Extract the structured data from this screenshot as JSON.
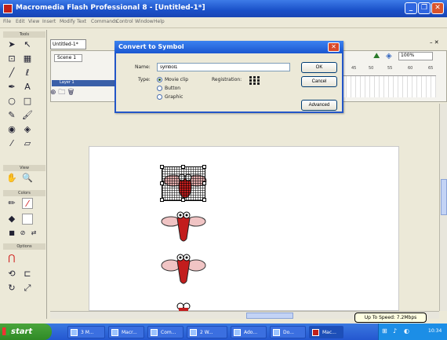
{
  "window": {
    "title": "Macromedia Flash Professional 8 - [Untitled-1*]",
    "min_label": "_",
    "max_label": "❐",
    "close_label": "✕"
  },
  "menu": [
    "File",
    "Edit",
    "View",
    "Insert",
    "Modify",
    "Text",
    "Commands",
    "Control",
    "Window",
    "Help"
  ],
  "tools": {
    "header": "Tools",
    "view_header": "View",
    "colors_header": "Colors",
    "options_header": "Options"
  },
  "document": {
    "tab": "Untitled-1*",
    "scene": "Scene 1",
    "layer": "Layer 1",
    "zoom": "100%",
    "ruler": [
      "45",
      "50",
      "55",
      "60",
      "65"
    ]
  },
  "dialog": {
    "title": "Convert to Symbol",
    "name_label": "Name:",
    "name_value": "symbol1",
    "type_label": "Type:",
    "types": [
      "Movie clip",
      "Button",
      "Graphic"
    ],
    "selected_type": "Movie clip",
    "registration_label": "Registration:",
    "ok": "OK",
    "cancel": "Cancel",
    "advanced": "Advanced"
  },
  "taskbar": {
    "start": "start",
    "tasks": [
      "3 M...",
      "Macr...",
      "Com...",
      "2 W...",
      "Ado...",
      "Do...",
      "Mac..."
    ],
    "tooltip": "Up To Speed: 7.2Mbps",
    "clock": "10:34"
  }
}
